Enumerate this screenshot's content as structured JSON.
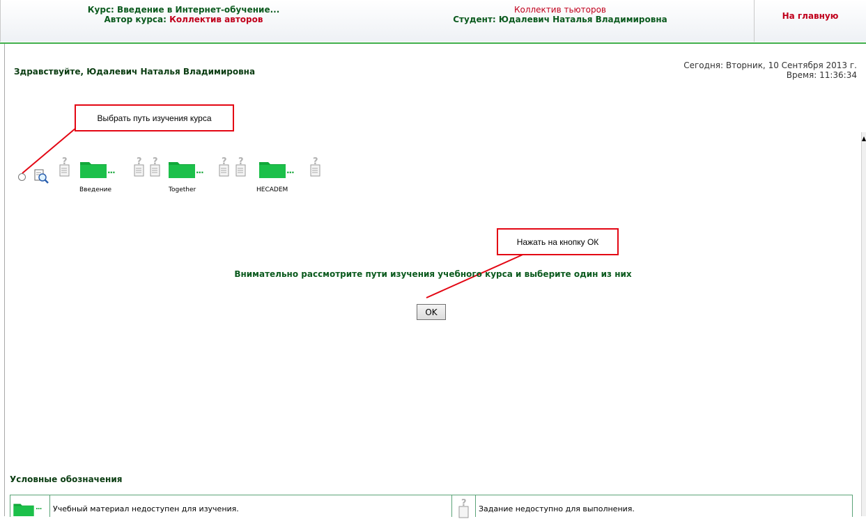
{
  "header": {
    "course_label": "Курс:",
    "course_name": "Введение в Интернет-обучение...",
    "author_label": "Автор курса:",
    "author_name": "Коллектив авторов",
    "tutors": "Коллектив тьюторов",
    "student_label": "Студент:",
    "student_name": "Юдалевич Наталья Владимировна",
    "home_link": "На главную"
  },
  "greeting": "Здравствуйте, Юдалевич Наталья Владимировна",
  "date": {
    "today": "Сегодня: Вторник, 10 Сентября 2013 г.",
    "time": "Время: 11:36:34"
  },
  "callouts": {
    "choose_path": "Выбрать путь изучения курса",
    "press_ok": "Нажать на кнопку ОК"
  },
  "path": {
    "folders": [
      "Введение",
      "Together",
      "HECADEM"
    ],
    "dots": "..."
  },
  "instruction": "Внимательно рассмотрите пути изучения учебного курса и выберите один из них",
  "ok_button": "OK",
  "legend": {
    "title": "Условные обозначения",
    "items": [
      {
        "icon": "folder-icon",
        "text": "Учебный материал недоступен для изучения."
      },
      {
        "icon": "task-icon",
        "text": "Задание недоступно для выполнения."
      }
    ]
  },
  "colors": {
    "accent_green": "#0b5a1e",
    "folder_green": "#1aa83c",
    "red": "#c0001c",
    "callout_border": "#e30613"
  }
}
